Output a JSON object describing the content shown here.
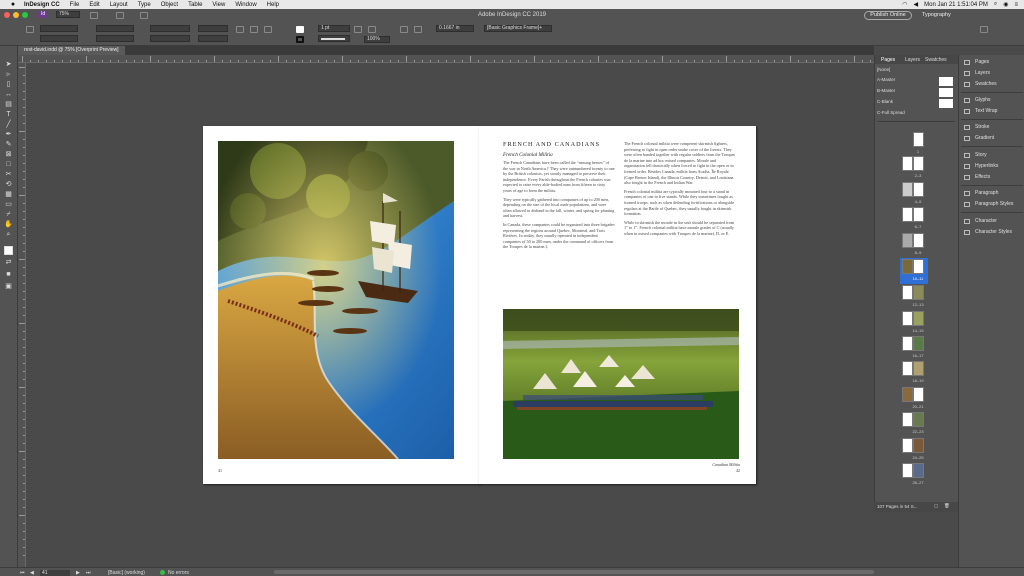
{
  "menubar": {
    "app_name": "InDesign CC",
    "items": [
      "File",
      "Edit",
      "Layout",
      "Type",
      "Object",
      "Table",
      "View",
      "Window",
      "Help"
    ],
    "clock": "Mon Jan 21  1:51:04 PM"
  },
  "window": {
    "title": "Adobe InDesign CC 2019",
    "publish_label": "Publish Online",
    "workspace": "Typography",
    "zoom_field": "75%",
    "stroke_weight": "1 pt",
    "scale": "100%",
    "measure": "0.1667 in",
    "frame_style": "[Basic Graphics Frame]+"
  },
  "document_tab": "rest-david.indd @ 75% [Overprint Preview]",
  "page_left": {
    "folio": "41"
  },
  "page_right": {
    "heading": "FRENCH AND CANADIANS",
    "subheading": "French Colonial Militia",
    "col1": [
      "The French Canadians have been called the “unsung heroes” of the war in North America.† They were outnumbered twenty to one by the British colonists, yet stoutly managed to preserve their independence. Every Parish throughout the French colonies was expected to raise every able-bodied man from fifteen to sixty years of age to form the militia.",
      "They were typically gathered into companies of up to 200 men, depending on the size of the local male populations, and were often allowed to disband in the fall, winter, and spring for planting and harvest.",
      "In Canada, these companies could be organized into three brigades representing the regions around Quebec, Montreal, and Trois Rivières. In reality, they usually operated in independent companies of 50 to 200 men, under the command of officers from the Troupes de la marine.‡"
    ],
    "col2": [
      "The French colonial militia were competent skirmish fighters, preferring to fight in open order under cover of the forests. They were often banded together with regular soldiers from the Troupes de la marine into ad hoc mixed companies. Morale and organization fell drastically when forced to fight in the open or in formed order. Besides Canada, militia from Acadia, Île Royale (Cape Breton Island), the Illinois Country, Detroit, and Louisiana also fought in the French and Indian War.",
      "French colonial militia are typically mounted four to a stand in companies of one to five stands. While they sometimes fought as formed troops, such as when defending fortifications or alongside regulars at the Battle of Quebec, they usually fought in skirmish formation.",
      "While in skirmish the moralе in the unit should be separated from 1” to 1”. French colonial militia have morale grades of C (usually when in mixed companies with Troupes de la marine), D, or E."
    ],
    "caption": "Canadian Militia",
    "folio": "42"
  },
  "pages_panel": {
    "tabs": [
      "Pages",
      "Layers",
      "Swatches"
    ],
    "masters": [
      "[None]",
      "A-Master",
      "B-Master",
      "C-Blank",
      "C-Full Spread"
    ],
    "spreads": [
      "1",
      "2–3",
      "4–5",
      "6–7",
      "8–9",
      "10–11",
      "12–13",
      "14–15",
      "16–17",
      "18–19",
      "20–21",
      "22–23",
      "24–25",
      "26–27"
    ],
    "footer": "107 Pages in 54 S..."
  },
  "dock": {
    "groups": [
      [
        "Pages",
        "Layers",
        "Swatches"
      ],
      [
        "Glyphs",
        "Text Wrap"
      ],
      [
        "Stroke",
        "Gradient"
      ],
      [
        "Story",
        "Hyperlinks",
        "Effects"
      ],
      [
        "Paragraph",
        "Paragraph Styles"
      ],
      [
        "Character",
        "Character Styles"
      ]
    ]
  },
  "status": {
    "page_number": "41",
    "style": "[Basic] (working)",
    "preflight": "No errors"
  },
  "colors": {
    "ui_dark": "#535353",
    "paste": "#4a4a4a",
    "selected_spread": "#2f6fd6",
    "preflight_ok": "#3dbb4a"
  }
}
